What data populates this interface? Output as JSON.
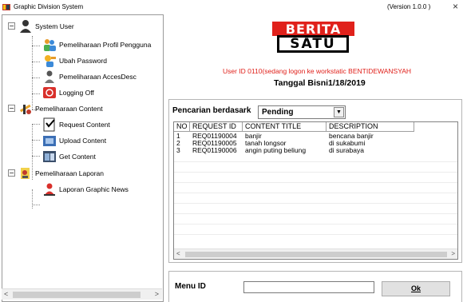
{
  "window": {
    "title": "Graphic Division System",
    "version": "(Version 1.0.0 )",
    "close_glyph": "×"
  },
  "tree": {
    "groups": [
      {
        "label": "System User",
        "expander": "−",
        "icon": "user-icon",
        "items": [
          {
            "label": "Pemeliharaan Profil Pengguna",
            "icon": "users-group-icon"
          },
          {
            "label": "Ubah Password",
            "icon": "key-user-icon"
          },
          {
            "label": "Pemeliharaan AccesDesc",
            "icon": "access-icon"
          },
          {
            "label": "Logging Off",
            "icon": "logoff-icon"
          }
        ]
      },
      {
        "label": "Pemeliharaan Content",
        "expander": "−",
        "icon": "tools-icon",
        "items": [
          {
            "label": "Request Content",
            "icon": "checklist-icon"
          },
          {
            "label": "Upload Content",
            "icon": "upload-icon"
          },
          {
            "label": "Get Content",
            "icon": "get-content-icon"
          }
        ]
      },
      {
        "label": "Pemeliharaan Laporan",
        "expander": "−",
        "icon": "report-icon",
        "items": [
          {
            "label": "Laporan Graphic News",
            "icon": "report-person-icon"
          }
        ]
      }
    ]
  },
  "logo": {
    "top": "BERITA",
    "bottom": "SATU",
    "colors": {
      "red": "#e0211b",
      "black": "#000000"
    }
  },
  "header": {
    "user_line": "User ID 0110(sedang logon ke  workstatic BENTIDEWANSYAH",
    "tanggal": "Tanggal Bisni1/18/2019"
  },
  "search": {
    "label": "Pencarian berdasark",
    "selected": "Pending"
  },
  "table": {
    "columns": [
      "NO",
      "REQUEST ID",
      "CONTENT TITLE",
      "DESCRIPTION"
    ],
    "rows": [
      [
        "1",
        "REQ01190004",
        "banjir",
        "bencana banjir"
      ],
      [
        "2",
        "REQ01190005",
        "tanah longsor",
        "di sukabumi"
      ],
      [
        "3",
        "REQ01190006",
        "angin puting beliung",
        "di surabaya"
      ]
    ]
  },
  "menu": {
    "label": "Menu ID",
    "value": "",
    "ok_label": "Ok"
  },
  "colors": {
    "accent_red": "#e0211b",
    "border": "#b5b5b5"
  }
}
